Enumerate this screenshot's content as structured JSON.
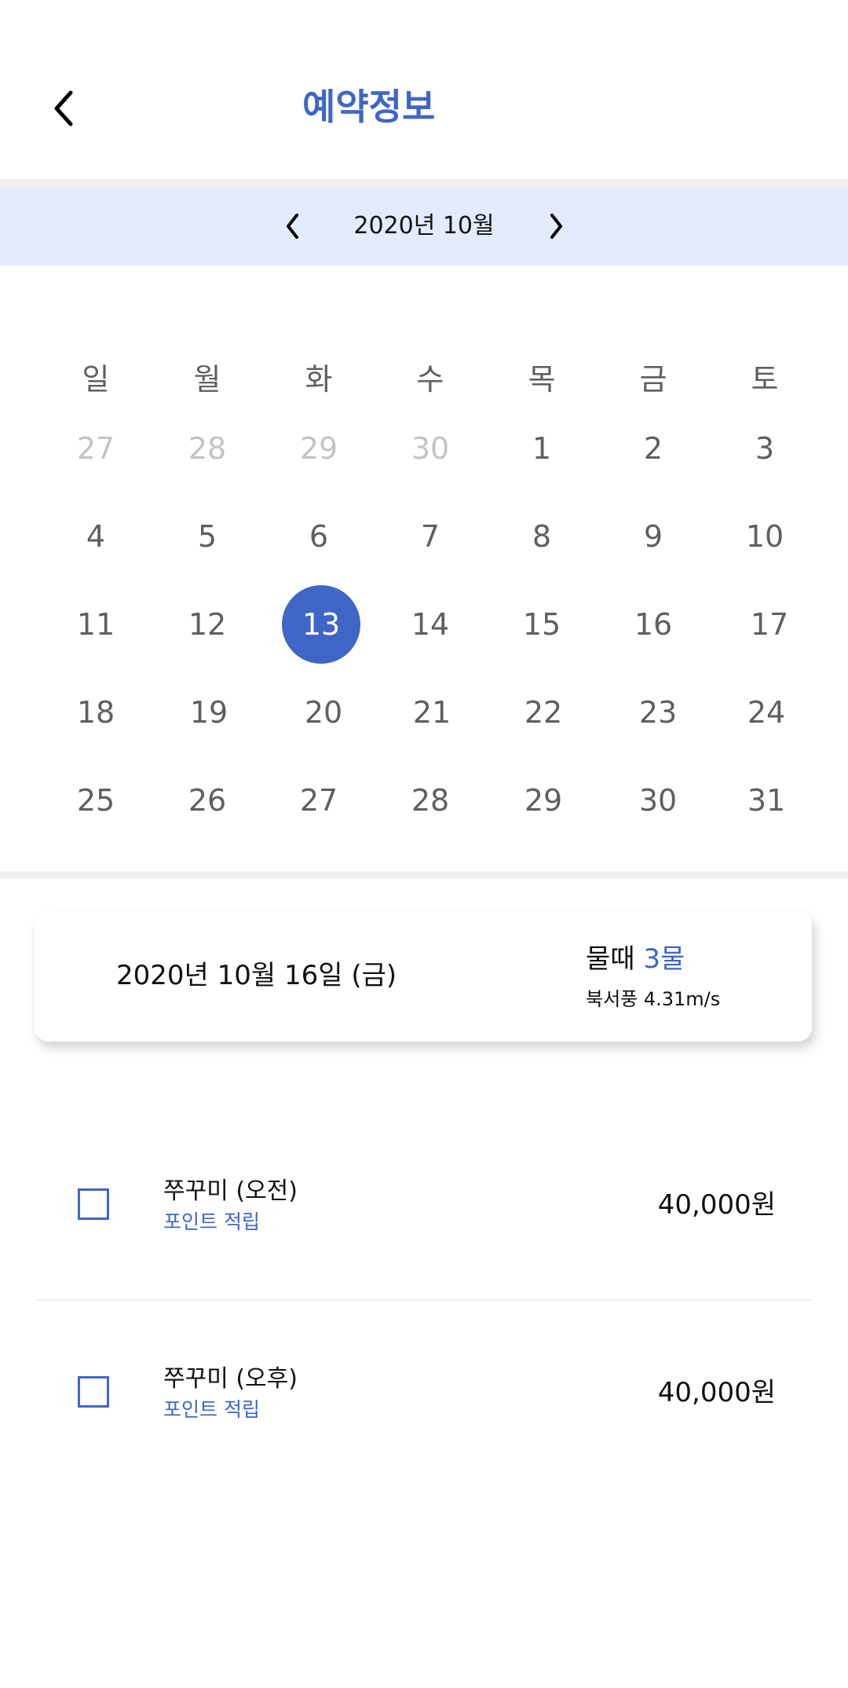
{
  "header": {
    "title": "예약정보",
    "back_icon": "chevron-left-icon"
  },
  "month_nav": {
    "label": "2020년 10월",
    "prev_icon": "chevron-left-icon",
    "next_icon": "chevron-right-icon"
  },
  "calendar": {
    "weekdays": [
      "일",
      "월",
      "화",
      "수",
      "목",
      "금",
      "토"
    ],
    "weeks": [
      [
        "27",
        "28",
        "29",
        "30",
        "1",
        "2",
        "3"
      ],
      [
        "4",
        "5",
        "6",
        "7",
        "8",
        "9",
        "10"
      ],
      [
        "11",
        "12",
        "13",
        "14",
        "15",
        "16",
        "17"
      ],
      [
        "18",
        "19",
        "20",
        "21",
        "22",
        "23",
        "24"
      ],
      [
        "25",
        "26",
        "27",
        "28",
        "29",
        "30",
        "31"
      ]
    ],
    "selected_day": "13",
    "accent_color": "#3F66C6"
  },
  "info": {
    "date": "2020년 10월 16일 (금)",
    "tide_label": "물때",
    "tide_value": "3물",
    "wind": "북서풍 4.31m/s"
  },
  "items": [
    {
      "name": "쭈꾸미 (오전)",
      "point": "포인트 적립",
      "price": "40,000원",
      "checked": false
    },
    {
      "name": "쭈꾸미 (오후)",
      "point": "포인트 적립",
      "price": "40,000원",
      "checked": false
    }
  ]
}
